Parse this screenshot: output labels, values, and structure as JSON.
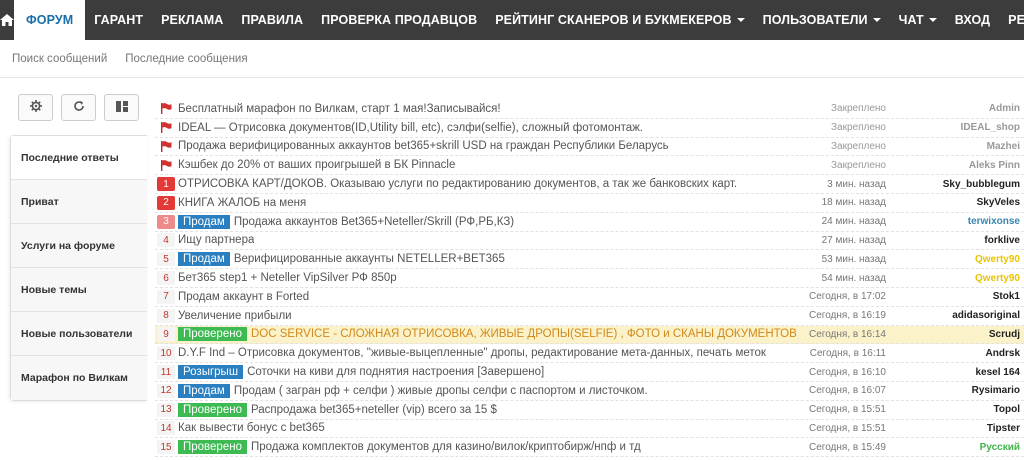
{
  "colors": {
    "nav_bg": "#3c3c3c",
    "active_nav_text": "#1a6fa8",
    "badge_sell": "#2a7fc0",
    "badge_checked": "#3dbb52",
    "badge_giveaway": "#2a7fc0",
    "user_teal": "#3a87ad",
    "user_yellow": "#e8c500",
    "user_green": "#41b34a",
    "highlight_row": "#fcf2c9"
  },
  "navbar": {
    "home_icon": "home-icon",
    "items": [
      {
        "label": "ФОРУМ",
        "active": true,
        "dropdown": false
      },
      {
        "label": "ГАРАНТ",
        "active": false,
        "dropdown": false
      },
      {
        "label": "РЕКЛАМА",
        "active": false,
        "dropdown": false
      },
      {
        "label": "ПРАВИЛА",
        "active": false,
        "dropdown": false
      },
      {
        "label": "ПРОВЕРКА ПРОДАВЦОВ",
        "active": false,
        "dropdown": false
      },
      {
        "label": "РЕЙТИНГ СКАНЕРОВ И БУКМЕКЕРОВ",
        "active": false,
        "dropdown": true
      },
      {
        "label": "ПОЛЬЗОВАТЕЛИ",
        "active": false,
        "dropdown": true
      },
      {
        "label": "ЧАТ",
        "active": false,
        "dropdown": true
      },
      {
        "label": "ВХОД",
        "active": false,
        "dropdown": false
      },
      {
        "label": "РЕГИСТРАЦИЯ",
        "active": false,
        "dropdown": false
      }
    ]
  },
  "subnav": {
    "search_messages": "Поиск сообщений",
    "recent_messages": "Последние сообщения"
  },
  "sidebar": {
    "tools": [
      "gear-icon",
      "refresh-icon",
      "layout-icon"
    ],
    "items": [
      {
        "label": "Последние ответы",
        "active": true
      },
      {
        "label": "Приват",
        "active": false
      },
      {
        "label": "Услуги на форуме",
        "active": false
      },
      {
        "label": "Новые темы",
        "active": false
      },
      {
        "label": "Новые пользователи",
        "active": false
      },
      {
        "label": "Марафон по Вилкам",
        "active": false
      }
    ]
  },
  "topics": [
    {
      "marker": "flag",
      "num": "",
      "badge": "",
      "title": "Бесплатный марафон по Вилкам, старт 1 мая!Записывайся!",
      "time": "Закреплено",
      "user": "Admin",
      "user_style": "pin"
    },
    {
      "marker": "flag",
      "num": "",
      "badge": "",
      "title": "IDEAL — Отрисовка документов(ID,Utility bill, etc), сэлфи(selfie), сложный фотомонтаж.",
      "time": "Закреплено",
      "user": "IDEAL_shop",
      "user_style": "pin"
    },
    {
      "marker": "flag",
      "num": "",
      "badge": "",
      "title": "Продажа верифицированных аккаунтов bet365+skrill USD на граждан Республики Беларусь",
      "time": "Закреплено",
      "user": "Mazhei",
      "user_style": "pin"
    },
    {
      "marker": "flag",
      "num": "",
      "badge": "",
      "title": "Кэшбек до 20% от ваших проигрышей в БК Pinnacle",
      "time": "Закреплено",
      "user": "Aleks Pinn",
      "user_style": "pin"
    },
    {
      "marker": "num",
      "num": "1",
      "num_style": "red",
      "badge": "",
      "title": "ОТРИСОВКА КАРТ/ДОКОВ. Оказываю услуги по редактированию документов, а так же банковских карт.",
      "time": "3 мин. назад",
      "user": "Sky_bubblegum",
      "user_style": "normal"
    },
    {
      "marker": "num",
      "num": "2",
      "num_style": "red",
      "badge": "",
      "title": "КНИГА ЖАЛОБ на меня",
      "time": "18 мин. назад",
      "user": "SkyVeles",
      "user_style": "normal"
    },
    {
      "marker": "num",
      "num": "3",
      "num_style": "pink",
      "badge": "Продам",
      "badge_type": "sell",
      "title": "Продажа аккаунтов Bet365+Neteller/Skrill (РФ,РБ,КЗ)",
      "time": "24 мин. назад",
      "user": "terwixonse",
      "user_style": "teal"
    },
    {
      "marker": "num",
      "num": "4",
      "num_style": "plain",
      "badge": "",
      "title": "Ищу партнера",
      "time": "27 мин. назад",
      "user": "forklive",
      "user_style": "normal"
    },
    {
      "marker": "num",
      "num": "5",
      "num_style": "plain",
      "badge": "Продам",
      "badge_type": "sell",
      "title": "Верифицированные аккаунты NETELLER+BET365",
      "time": "53 мин. назад",
      "user": "Qwerty90",
      "user_style": "yellow"
    },
    {
      "marker": "num",
      "num": "6",
      "num_style": "plain",
      "badge": "",
      "title": "Бет365 step1 + Neteller VipSilver РФ 850р",
      "time": "54 мин. назад",
      "user": "Qwerty90",
      "user_style": "yellow"
    },
    {
      "marker": "num",
      "num": "7",
      "num_style": "plain",
      "badge": "",
      "title": "Продам аккаунт в Forted",
      "time": "Сегодня, в 17:02",
      "user": "Stok1",
      "user_style": "normal"
    },
    {
      "marker": "num",
      "num": "8",
      "num_style": "plain",
      "badge": "",
      "title": "Увеличение прибыли",
      "time": "Сегодня, в 16:19",
      "user": "adidasoriginal",
      "user_style": "normal"
    },
    {
      "marker": "num",
      "num": "9",
      "num_style": "plain",
      "badge": "Проверено",
      "badge_type": "checked",
      "title": "DOC SERVICE - СЛОЖНАЯ ОТРИСОВКА, ЖИВЫЕ ДРОПЫ(SELFIE) , ФОТО и СКАНЫ ДОКУМЕНТОВ",
      "title_style": "gold",
      "highlight": true,
      "time": "Сегодня, в 16:14",
      "user": "Scrudj",
      "user_style": "normal"
    },
    {
      "marker": "num",
      "num": "10",
      "num_style": "plain",
      "badge": "",
      "title": "D.Y.F Ind  – Отрисовка документов, \"живые-выцепленные\" дропы, редактирование мета-данных, печать меток",
      "time": "Сегодня, в 16:11",
      "user": "Andrsk",
      "user_style": "normal"
    },
    {
      "marker": "num",
      "num": "11",
      "num_style": "plain",
      "badge": "Розыгрыш",
      "badge_type": "giveaway",
      "title": "Соточки на киви для поднятия настроения [Завершено]",
      "time": "Сегодня, в 16:10",
      "user": "kesel 164",
      "user_style": "normal"
    },
    {
      "marker": "num",
      "num": "12",
      "num_style": "plain",
      "badge": "Продам",
      "badge_type": "sell",
      "title": "Продам ( загран рф + селфи ) живые дропы селфи с паспортом и листочком.",
      "time": "Сегодня, в 16:07",
      "user": "Rysimario",
      "user_style": "normal"
    },
    {
      "marker": "num",
      "num": "13",
      "num_style": "plain",
      "badge": "Проверено",
      "badge_type": "checked",
      "title": "Распродажа bet365+neteller (vip) всего за 15 $",
      "time": "Сегодня, в 15:51",
      "user": "Topol",
      "user_style": "normal"
    },
    {
      "marker": "num",
      "num": "14",
      "num_style": "plain",
      "badge": "",
      "title": "Как вывести бонус с bet365",
      "time": "Сегодня, в 15:51",
      "user": "Tipster",
      "user_style": "normal"
    },
    {
      "marker": "num",
      "num": "15",
      "num_style": "plain",
      "badge": "Проверено",
      "badge_type": "checked",
      "title": "Продажа комплектов документов для казино/вилок/криптобирж/нпф и тд",
      "time": "Сегодня, в 15:49",
      "user": "Русский",
      "user_style": "green"
    }
  ]
}
